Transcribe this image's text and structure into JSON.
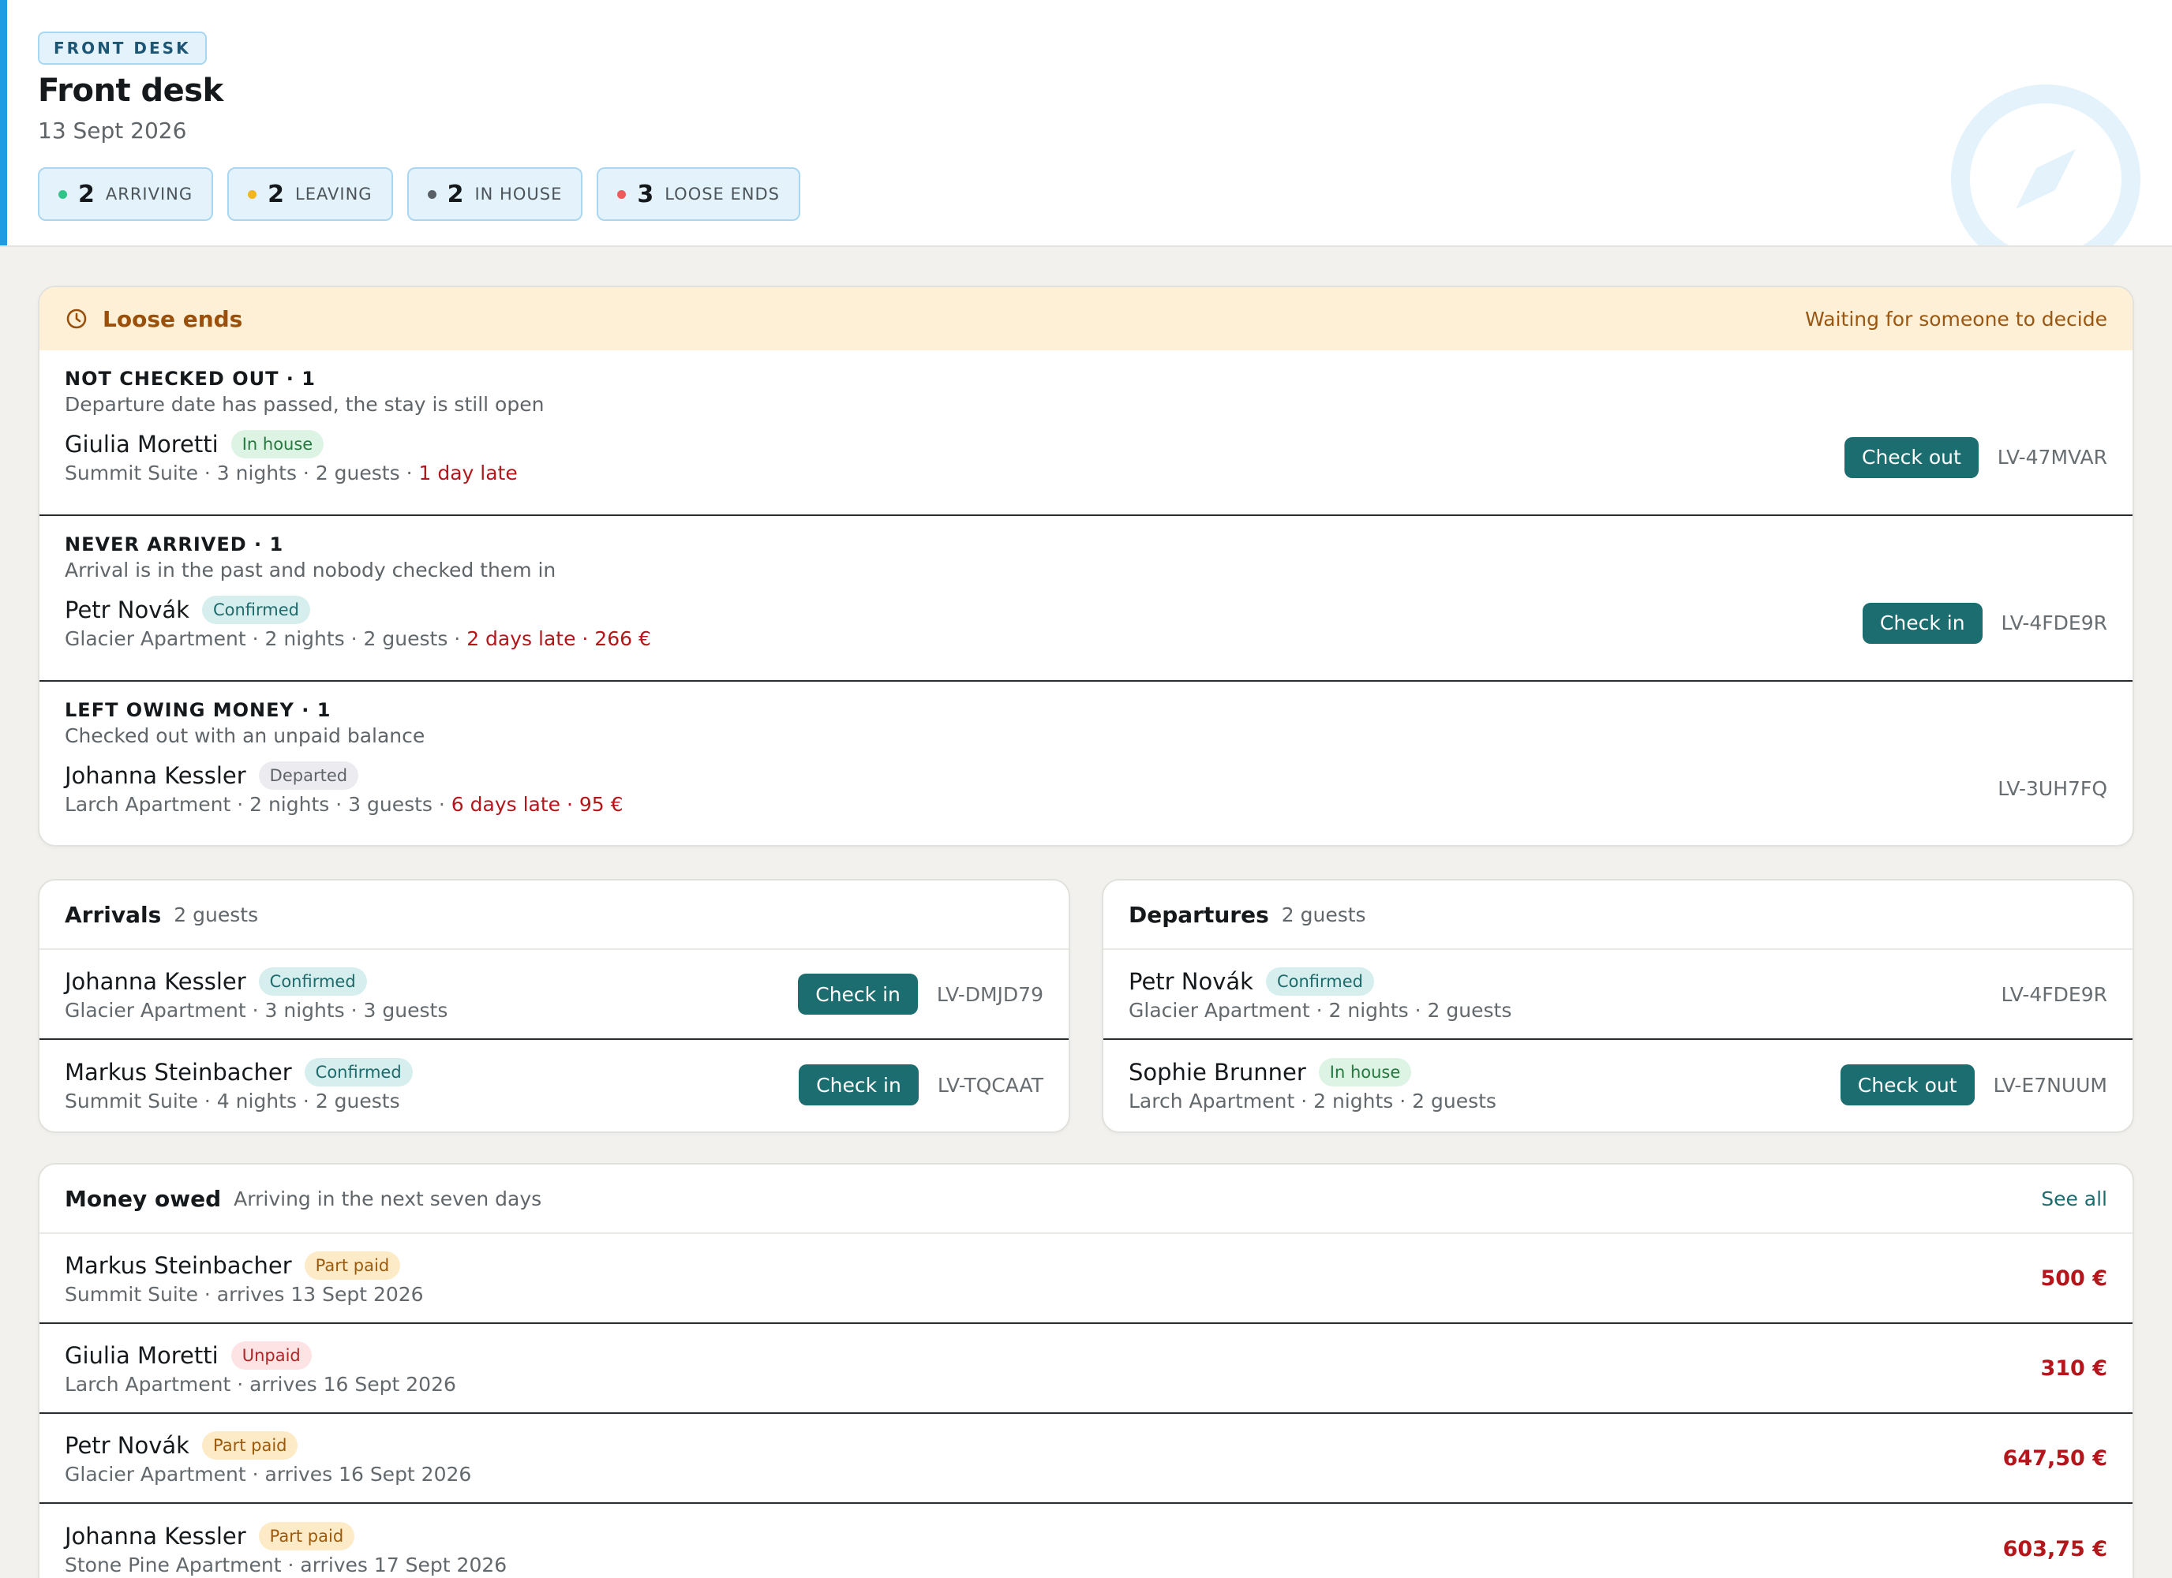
{
  "header": {
    "eyebrow": "FRONT DESK",
    "title": "Front desk",
    "date": "13 Sept 2026",
    "stats": [
      {
        "count": "2",
        "label": "ARRIVING",
        "color": "#2fc58a"
      },
      {
        "count": "2",
        "label": "LEAVING",
        "color": "#f2b51d"
      },
      {
        "count": "2",
        "label": "IN HOUSE",
        "color": "#5a6166"
      },
      {
        "count": "3",
        "label": "LOOSE ENDS",
        "color": "#ef5b5b"
      }
    ]
  },
  "loose_ends": {
    "title": "Loose ends",
    "note": "Waiting for someone to decide",
    "groups": [
      {
        "title": "NOT CHECKED OUT · 1",
        "desc": "Departure date has passed, the stay is still open",
        "guest": "Giulia Moretti",
        "badge": "In house",
        "meta": "Summit Suite · 3 nights · 2 guests · ",
        "late": "1 day late",
        "action": "Check out",
        "ref": "LV-47MVAR"
      },
      {
        "title": "NEVER ARRIVED · 1",
        "desc": "Arrival is in the past and nobody checked them in",
        "guest": "Petr Novák",
        "badge": "Confirmed",
        "meta": "Glacier Apartment · 2 nights · 2 guests · ",
        "late": "2 days late · 266 €",
        "action": "Check in",
        "ref": "LV-4FDE9R"
      },
      {
        "title": "LEFT OWING MONEY · 1",
        "desc": "Checked out with an unpaid balance",
        "guest": "Johanna Kessler",
        "badge": "Departed",
        "meta": "Larch Apartment · 2 nights · 3 guests · ",
        "late": "6 days late · 95 €",
        "ref": "LV-3UH7FQ"
      }
    ]
  },
  "arrivals": {
    "title": "Arrivals",
    "count": "2 guests",
    "rows": [
      {
        "guest": "Johanna Kessler",
        "badge": "Confirmed",
        "meta": "Glacier Apartment · 3 nights · 3 guests",
        "action": "Check in",
        "ref": "LV-DMJD79"
      },
      {
        "guest": "Markus Steinbacher",
        "badge": "Confirmed",
        "meta": "Summit Suite · 4 nights · 2 guests",
        "action": "Check in",
        "ref": "LV-TQCAAT"
      }
    ]
  },
  "departures": {
    "title": "Departures",
    "count": "2 guests",
    "rows": [
      {
        "guest": "Petr Novák",
        "badge": "Confirmed",
        "meta": "Glacier Apartment · 2 nights · 2 guests",
        "ref": "LV-4FDE9R"
      },
      {
        "guest": "Sophie Brunner",
        "badge": "In house",
        "meta": "Larch Apartment · 2 nights · 2 guests",
        "action": "Check out",
        "ref": "LV-E7NUUM"
      }
    ]
  },
  "money_owed": {
    "title": "Money owed",
    "subtitle": "Arriving in the next seven days",
    "see_all": "See all",
    "rows": [
      {
        "guest": "Markus Steinbacher",
        "badge": "Part paid",
        "meta": "Summit Suite · arrives 13 Sept 2026",
        "amount": "500 €"
      },
      {
        "guest": "Giulia Moretti",
        "badge": "Unpaid",
        "meta": "Larch Apartment · arrives 16 Sept 2026",
        "amount": "310 €"
      },
      {
        "guest": "Petr Novák",
        "badge": "Part paid",
        "meta": "Glacier Apartment · arrives 16 Sept 2026",
        "amount": "647,50 €"
      },
      {
        "guest": "Johanna Kessler",
        "badge": "Part paid",
        "meta": "Stone Pine Apartment · arrives 17 Sept 2026",
        "amount": "603,75 €"
      }
    ]
  }
}
